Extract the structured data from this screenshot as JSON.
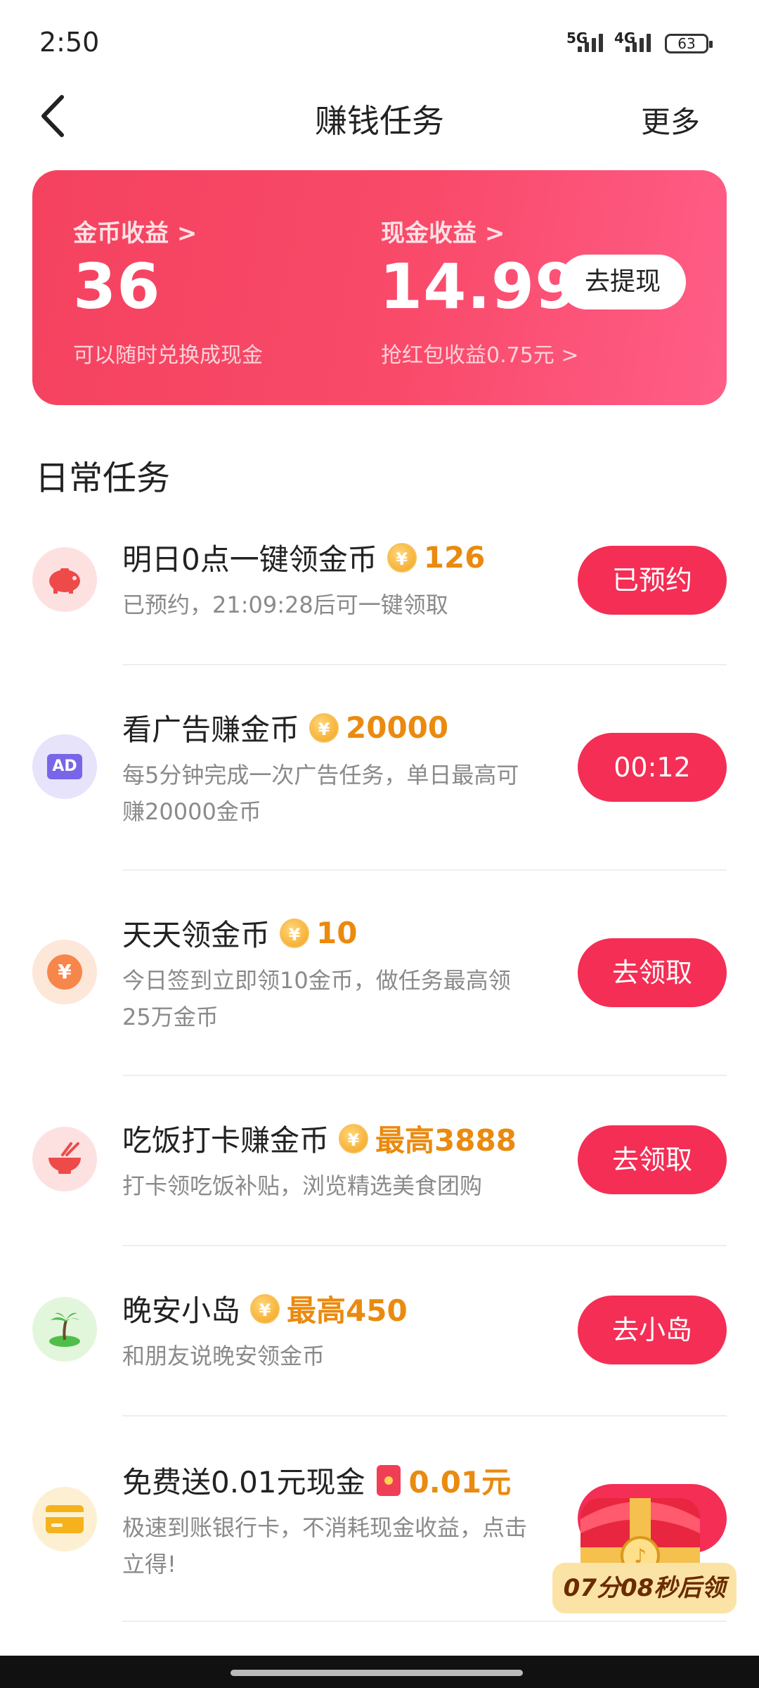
{
  "status": {
    "time": "2:50",
    "net1": "5G",
    "net2": "4G",
    "battery": "63"
  },
  "nav": {
    "title": "赚钱任务",
    "more": "更多"
  },
  "card": {
    "coin_label": "金币收益 >",
    "coin_value": "36",
    "coin_sub": "可以随时兑换成现金",
    "cash_label": "现金收益 >",
    "cash_value": "14.99",
    "cash_sub": "抢红包收益0.75元 >",
    "withdraw": "去提现"
  },
  "section_title": "日常任务",
  "tasks": [
    {
      "title": "明日0点一键领金币",
      "reward": "126",
      "desc": "已预约，21:09:28后可一键领取",
      "button": "已预约",
      "icon": "piggy-bank-icon"
    },
    {
      "title": "看广告赚金币",
      "reward": "20000",
      "desc": "每5分钟完成一次广告任务，单日最高可赚20000金币",
      "button": "00:12",
      "icon": "ad-icon"
    },
    {
      "title": "天天领金币",
      "reward": "10",
      "desc": "今日签到立即领10金币，做任务最高领25万金币",
      "button": "去领取",
      "icon": "yuan-coin-icon"
    },
    {
      "title": "吃饭打卡赚金币",
      "reward": "最高3888",
      "desc": "打卡领吃饭补贴，浏览精选美食团购",
      "button": "去领取",
      "icon": "rice-bowl-icon"
    },
    {
      "title": "晚安小岛",
      "reward": "最高450",
      "desc": "和朋友说晚安领金币",
      "button": "去小岛",
      "icon": "island-icon"
    },
    {
      "title": "免费送0.01元现金",
      "reward": "0.01元",
      "desc": "极速到账银行卡，不消耗现金收益，点击立得!",
      "button": "",
      "icon": "bank-card-icon"
    }
  ],
  "floating": {
    "countdown": "07分08秒后领"
  },
  "colors": {
    "accent": "#f42e55",
    "card_start": "#f4425f",
    "card_end": "#ff5d87",
    "reward": "#ea8a0f"
  }
}
